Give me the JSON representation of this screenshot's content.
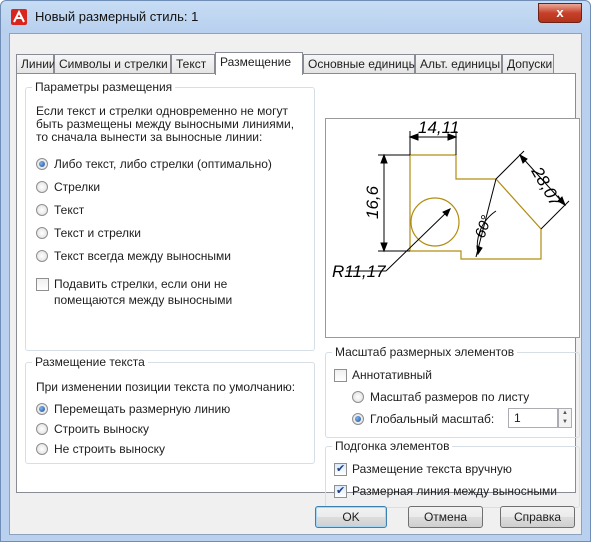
{
  "window": {
    "title": "Новый размерный стиль: 1",
    "close_label": "x"
  },
  "tabs": [
    {
      "label": "Линии"
    },
    {
      "label": "Символы и стрелки"
    },
    {
      "label": "Текст"
    },
    {
      "label": "Размещение",
      "active": true
    },
    {
      "label": "Основные единицы"
    },
    {
      "label": "Альт. единицы"
    },
    {
      "label": "Допуски"
    }
  ],
  "fit_options": {
    "title": "Параметры размещения",
    "description": [
      "Если текст и стрелки одновременно не могут",
      "быть размещены между выносными линиями,",
      "то сначала вынести за выносные линии:"
    ],
    "options": [
      {
        "label": "Либо текст, либо стрелки (оптимально)",
        "selected": true
      },
      {
        "label": "Стрелки",
        "selected": false
      },
      {
        "label": "Текст",
        "selected": false
      },
      {
        "label": "Текст и стрелки",
        "selected": false
      },
      {
        "label": "Текст всегда между выносными",
        "selected": false
      }
    ],
    "suppress_arrows": {
      "label": [
        "Подавить стрелки, если они не",
        "помещаются между выносными"
      ],
      "checked": false
    }
  },
  "text_placement": {
    "title": "Размещение текста",
    "description": "При изменении позиции текста по умолчанию:",
    "options": [
      {
        "label": "Перемещать размерную линию",
        "selected": true
      },
      {
        "label": "Строить выноску",
        "selected": false
      },
      {
        "label": "Не строить выноску",
        "selected": false
      }
    ]
  },
  "preview": {
    "dim_top": "14,11",
    "dim_left": "16,6",
    "dim_right": "28,07",
    "dim_angle": "60°",
    "dim_radius": "R11,17"
  },
  "scale": {
    "title": "Масштаб размерных элементов",
    "annotative": {
      "label": "Аннотативный",
      "checked": false
    },
    "scale_to_layout": {
      "label": "Масштаб размеров по листу",
      "selected": false
    },
    "global_scale": {
      "label": "Глобальный масштаб:",
      "selected": true,
      "value": "1"
    }
  },
  "fine_tuning": {
    "title": "Подгонка элементов",
    "manual_text": {
      "label": "Размещение текста вручную",
      "checked": true
    },
    "dim_line_between": {
      "label": "Размерная линия между выносными",
      "checked": true
    }
  },
  "buttons": {
    "ok": "OK",
    "cancel": "Отмена",
    "help": "Справка"
  },
  "colors": {
    "titlebar": "#b9d1ef",
    "close": "#c7412a",
    "drawing": "#b28d12"
  }
}
